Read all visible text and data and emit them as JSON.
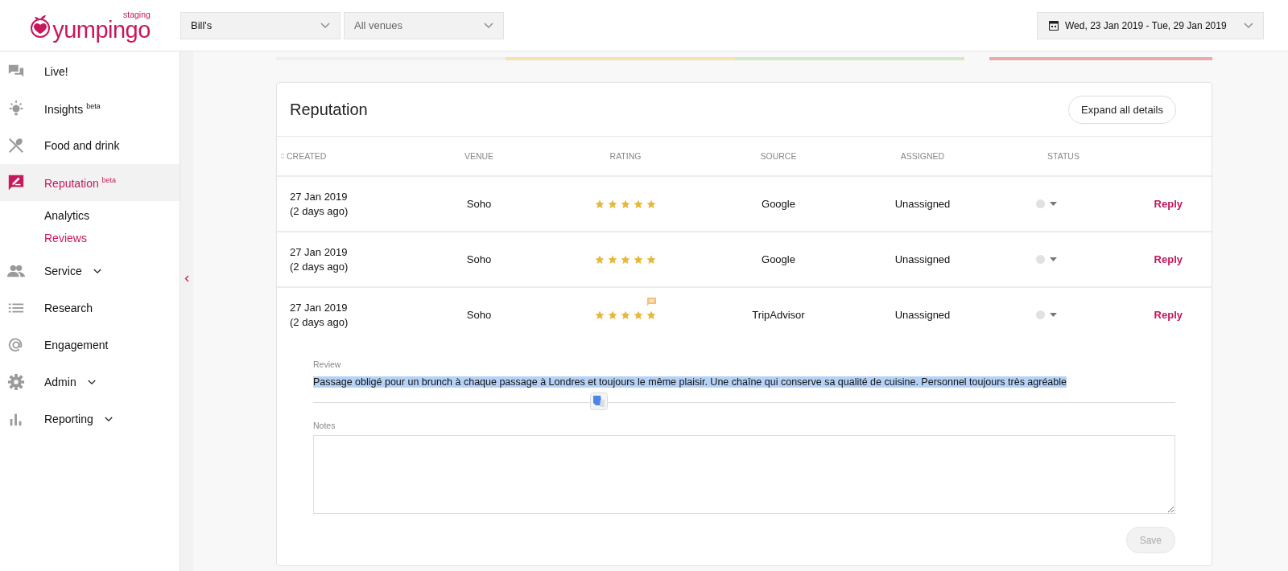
{
  "logo": {
    "wordmark": "yumpingo",
    "environment": "staging"
  },
  "filters": [
    {
      "value": "Bill's",
      "muted": false
    },
    {
      "value": "All venues",
      "muted": true
    }
  ],
  "date_range": {
    "value": "Wed, 23 Jan 2019 - Tue, 29 Jan 2019"
  },
  "sidebar": {
    "items": [
      {
        "label": "Live!",
        "selected": false
      },
      {
        "label": "Insights $^{beta}$",
        "selected": false
      },
      {
        "label": "Food and drink",
        "selected": false
      },
      {
        "label": "Reputation $^{beta}$",
        "selected": true,
        "children": [
          {
            "label": "Analytics",
            "selected": false
          },
          {
            "label": "Reviews",
            "selected": true
          }
        ]
      },
      {
        "label": "Service",
        "selected": false,
        "expandable": true
      },
      {
        "label": "Research",
        "selected": false
      },
      {
        "label": "Engagement",
        "selected": false
      },
      {
        "label": "Admin",
        "selected": false,
        "expandable": true
      },
      {
        "label": "Reporting",
        "selected": false,
        "expandable": true
      }
    ]
  },
  "score_bar": [
    {
      "color": "#efefef"
    },
    {
      "color": "#f7e2b6"
    },
    {
      "color": "#d3e8c6"
    },
    {
      "color": "#e9abab"
    }
  ],
  "card": {
    "title": "Reputation",
    "expand_button": "Expand all details",
    "table": {
      "columns": [
        "CREATED",
        "VENUE",
        "RATING",
        "SOURCE",
        "ASSIGNED",
        "STATUS"
      ],
      "rows": [
        {
          "created": "27 Jan 2019",
          "age": "(2 days ago)",
          "venue": "Soho",
          "stars": 5,
          "has_comment": false,
          "source": "Google",
          "assigned": "Unassigned",
          "action": "Reply",
          "expanded": false
        },
        {
          "created": "27 Jan 2019",
          "age": "(2 days ago)",
          "venue": "Soho",
          "stars": 5,
          "has_comment": false,
          "source": "Google",
          "assigned": "Unassigned",
          "action": "Reply",
          "expanded": false
        },
        {
          "created": "27 Jan 2019",
          "age": "(2 days ago)",
          "venue": "Soho",
          "stars": 5,
          "has_comment": true,
          "source": "TripAdvisor",
          "assigned": "Unassigned",
          "action": "Reply",
          "expanded": true
        }
      ]
    },
    "details": {
      "review_label": "Review",
      "review": "Passage obligé pour un brunch à chaque passage à Londres et toujours le même plaisir. Une chaîne qui conserve sa qualité de cuisine. Personnel toujours très agréable",
      "highlighted": true,
      "notes_label": "Notes",
      "save": {
        "label": "Save",
        "disabled": true
      }
    }
  }
}
